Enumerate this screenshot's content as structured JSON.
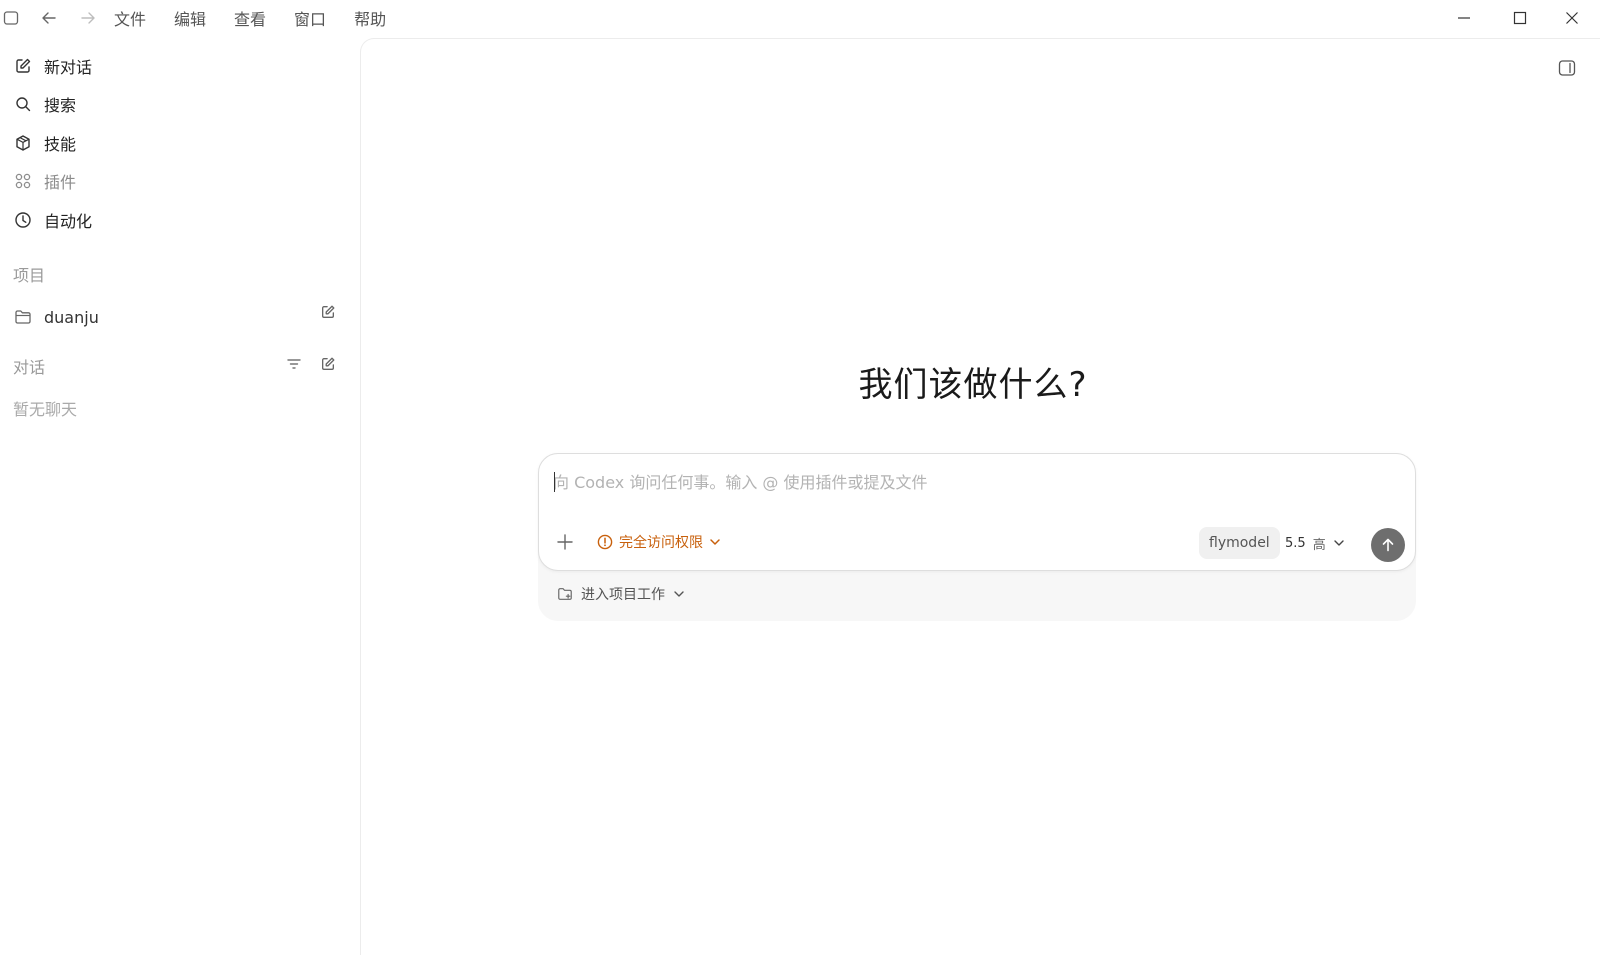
{
  "titlebar": {
    "menu": [
      "文件",
      "编辑",
      "查看",
      "窗口",
      "帮助"
    ],
    "icons": [
      "sidebar-toggle-icon",
      "back-arrow-icon",
      "forward-arrow-icon",
      "minimize-icon",
      "maximize-icon",
      "close-icon"
    ]
  },
  "sidebar": {
    "nav": [
      {
        "label": "新对话",
        "icon": "new-chat-icon"
      },
      {
        "label": "搜索",
        "icon": "search-icon"
      },
      {
        "label": "技能",
        "icon": "skills-cube-icon"
      },
      {
        "label": "插件",
        "icon": "plugins-grid-icon",
        "dimmed": true
      },
      {
        "label": "自动化",
        "icon": "clock-icon"
      }
    ],
    "projects_label": "项目",
    "project": {
      "name": "duanju",
      "icon": "folder-icon"
    },
    "chats_label": "对话",
    "empty_chats": "暂无聊天"
  },
  "main": {
    "headline": "我们该做什么?",
    "composer": {
      "placeholder": "向 Codex 询问任何事。输入 @ 使用插件或提及文件",
      "value": "",
      "access_label": "完全访问权限",
      "model": "flymodel",
      "version": "5.5",
      "effort": "高",
      "project_label": "进入项目工作"
    }
  },
  "colors": {
    "accent_orange": "#c8600c",
    "send_button": "#6e6e6e",
    "border": "#dedede"
  }
}
